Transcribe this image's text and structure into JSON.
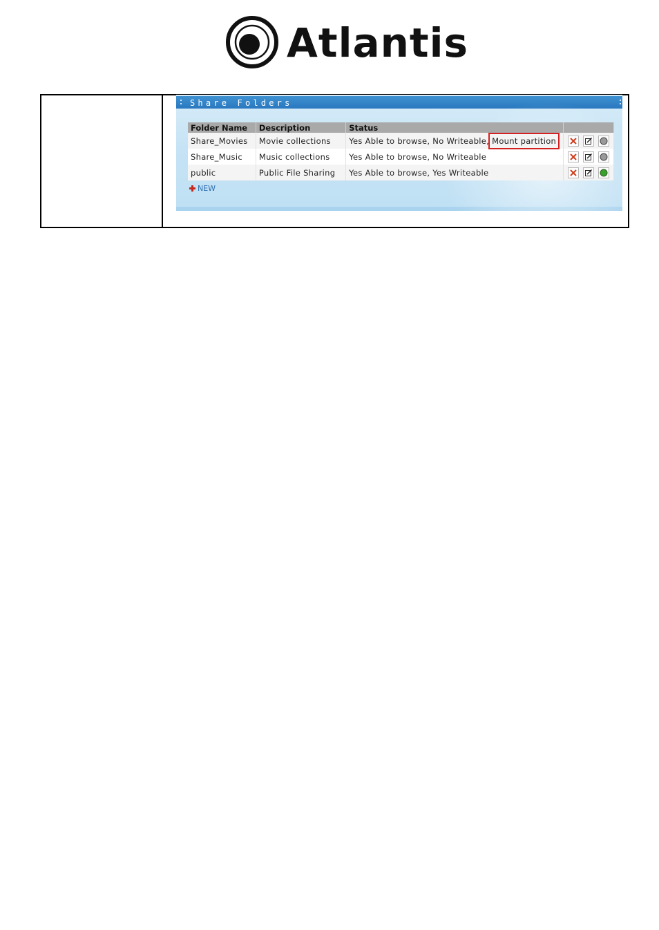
{
  "logo": {
    "brand_text": "Atlantis"
  },
  "panel": {
    "title": "Share Folders"
  },
  "table": {
    "columns": [
      "Folder Name",
      "Description",
      "Status",
      ""
    ],
    "rows": [
      {
        "folder": "Share_Movies",
        "description": "Movie collections",
        "status": "Yes Able to browse, No Writeable,",
        "status_extra": "Mount partition",
        "active": false
      },
      {
        "folder": "Share_Music",
        "description": "Music collections",
        "status": "Yes Able to browse, No Writeable",
        "status_extra": "",
        "active": false
      },
      {
        "folder": "public",
        "description": "Public File Sharing",
        "status": "Yes Able to browse, Yes Writeable",
        "status_extra": "",
        "active": true
      }
    ]
  },
  "new_link": {
    "label": "NEW"
  },
  "colors": {
    "header_bar": "#2a78bf",
    "highlight": "#d32020",
    "active_dot": "#3aa02c",
    "inactive_dot": "#9a9a9a",
    "delete": "#d03a1a"
  },
  "icons": [
    "delete-icon",
    "edit-icon",
    "status-dot-icon",
    "add-icon"
  ]
}
